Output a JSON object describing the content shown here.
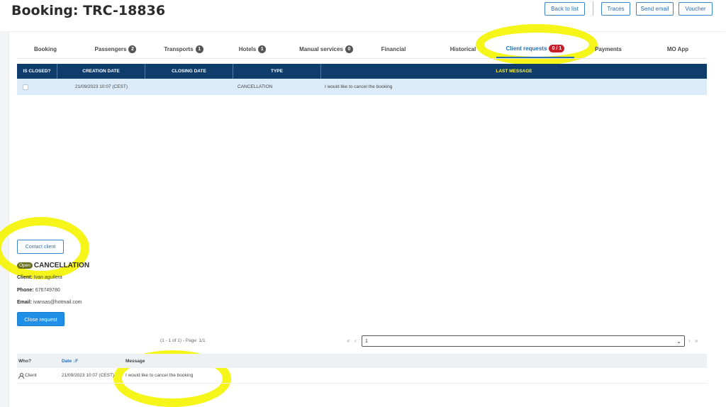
{
  "header": {
    "title": "Booking: TRC-18836",
    "buttons": {
      "back": "Back to list",
      "traces": "Traces",
      "send_email": "Send email",
      "voucher": "Voucher"
    }
  },
  "tabs": [
    {
      "label": "Booking",
      "count": ""
    },
    {
      "label": "Passengers",
      "count": "2"
    },
    {
      "label": "Transports",
      "count": "1"
    },
    {
      "label": "Hotels",
      "count": "1"
    },
    {
      "label": "Manual services",
      "count": "0"
    },
    {
      "label": "Financial",
      "count": ""
    },
    {
      "label": "Historical",
      "count": ""
    },
    {
      "label": "Client requests",
      "count": "0 / 1"
    },
    {
      "label": "Payments",
      "count": ""
    },
    {
      "label": "MO App",
      "count": ""
    }
  ],
  "active_tab": "Client requests",
  "requests_table": {
    "columns": [
      "IS CLOSED?",
      "CREATION DATE",
      "CLOSING DATE",
      "TYPE",
      "LAST MESSAGE"
    ],
    "rows": [
      {
        "is_closed": false,
        "creation_date": "21/09/2023 10:07 (CEST)",
        "closing_date": "",
        "type": "CANCELLATION",
        "last_message": "I would like to cancel the booking"
      }
    ]
  },
  "detail": {
    "contact_button": "Contact client",
    "status_badge": "Open",
    "request_type": "CANCELLATION",
    "client_label": "Client:",
    "client_value": "Ivan aguilera",
    "phone_label": "Phone:",
    "phone_value": "676749780",
    "email_label": "Email:",
    "email_value": "ivansas@hotmail.com",
    "close_button": "Close request"
  },
  "pager": {
    "summary": "(1 - 1 of 1) - Page: 1/1",
    "first": "«",
    "prev": "‹",
    "selected_page": "1",
    "next": "›",
    "last": "»"
  },
  "messages_table": {
    "columns": {
      "who": "Who?",
      "date": "Date ↓F",
      "message": "Message"
    },
    "rows": [
      {
        "who": "Client",
        "date": "21/09/2023 10:07 (CEST)",
        "message": "I would like to cancel the booking"
      }
    ]
  },
  "colors": {
    "header_navy": "#0e3d6b",
    "accent_blue": "#2a6eb0",
    "highlighter_yellow": "#f4f400",
    "badge_red": "#c81e2a"
  },
  "icons": [
    "user-icon",
    "caret-down-icon"
  ]
}
